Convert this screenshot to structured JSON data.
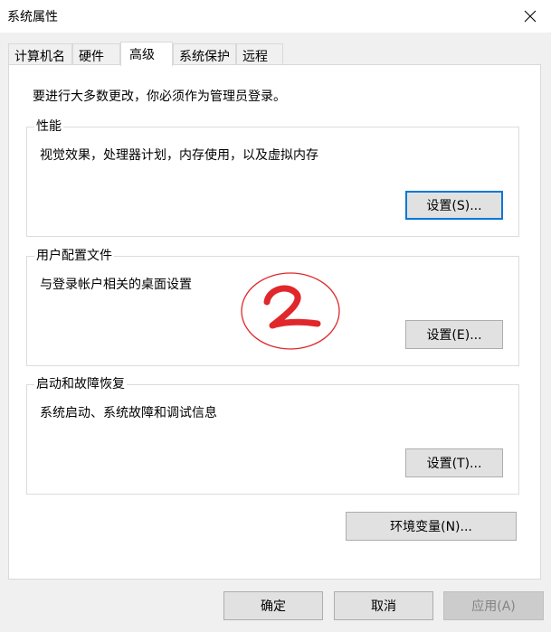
{
  "window": {
    "title": "系统属性"
  },
  "tabs": [
    {
      "label": "计算机名"
    },
    {
      "label": "硬件"
    },
    {
      "label": "高级",
      "active": true
    },
    {
      "label": "系统保护"
    },
    {
      "label": "远程"
    }
  ],
  "panel": {
    "notice": "要进行大多数更改，你必须作为管理员登录。",
    "groups": {
      "performance": {
        "title": "性能",
        "description": "视觉效果，处理器计划，内存使用，以及虚拟内存",
        "button": "设置(S)..."
      },
      "profiles": {
        "title": "用户配置文件",
        "description": "与登录帐户相关的桌面设置",
        "button": "设置(E)..."
      },
      "startup": {
        "title": "启动和故障恢复",
        "description": "系统启动、系统故障和调试信息",
        "button": "设置(T)..."
      }
    },
    "env_button": "环境变量(N)..."
  },
  "annotation": {
    "text": "2",
    "color": "#e0282c"
  },
  "footer": {
    "ok": "确定",
    "cancel": "取消",
    "apply": "应用(A)"
  },
  "icons": {
    "close": "close-icon"
  }
}
